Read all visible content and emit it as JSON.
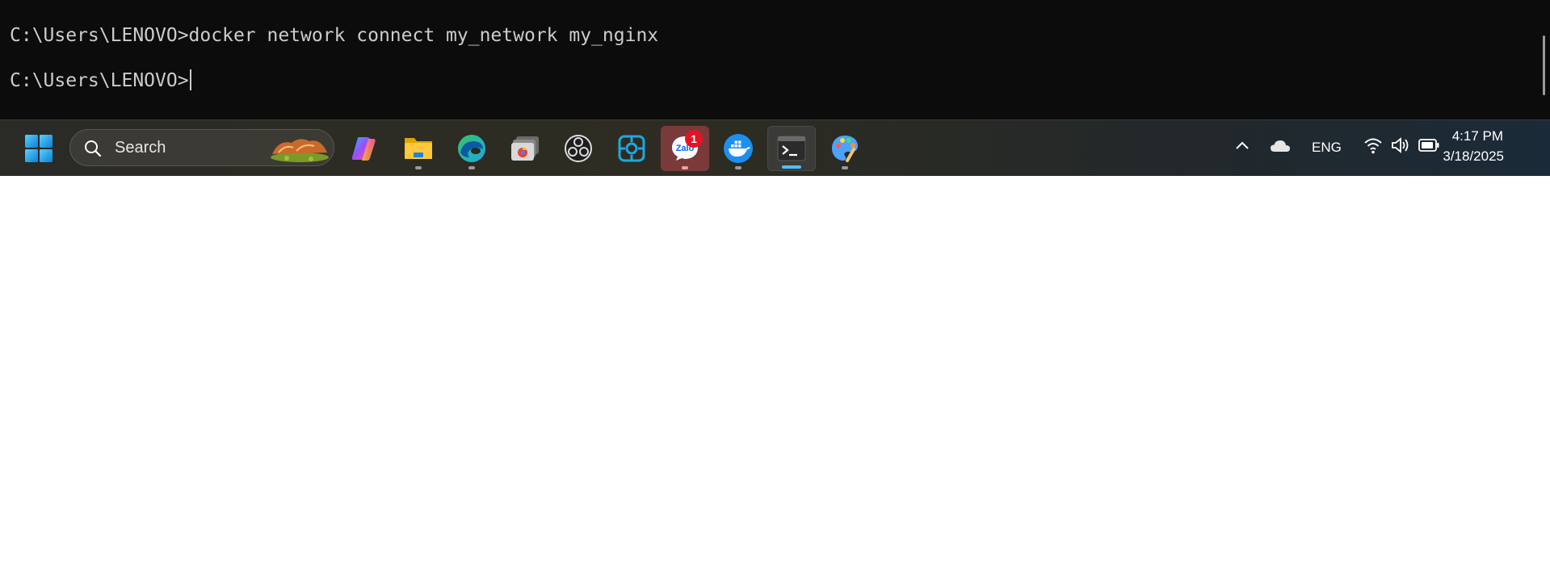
{
  "terminal": {
    "partial_top_line": "              ·                        ·",
    "command_line": "C:\\Users\\LENOVO>docker network connect my_network my_nginx",
    "prompt_line": "C:\\Users\\LENOVO>"
  },
  "taskbar": {
    "search_label": "Search",
    "apps": [
      {
        "name": "Copilot"
      },
      {
        "name": "File Explorer"
      },
      {
        "name": "Microsoft Edge"
      },
      {
        "name": "Photos"
      },
      {
        "name": "OBS Studio"
      },
      {
        "name": "Capture tool"
      },
      {
        "name": "Zalo",
        "badge": "1",
        "label": "Zalo"
      },
      {
        "name": "Docker Desktop"
      },
      {
        "name": "Terminal"
      },
      {
        "name": "Paint"
      }
    ],
    "tray": {
      "language": "ENG",
      "time": "4:17 PM",
      "date": "3/18/2025"
    }
  },
  "colors": {
    "terminal_bg": "#0c0c0c",
    "terminal_fg": "#cccccc",
    "accent": "#4cc2ff"
  }
}
